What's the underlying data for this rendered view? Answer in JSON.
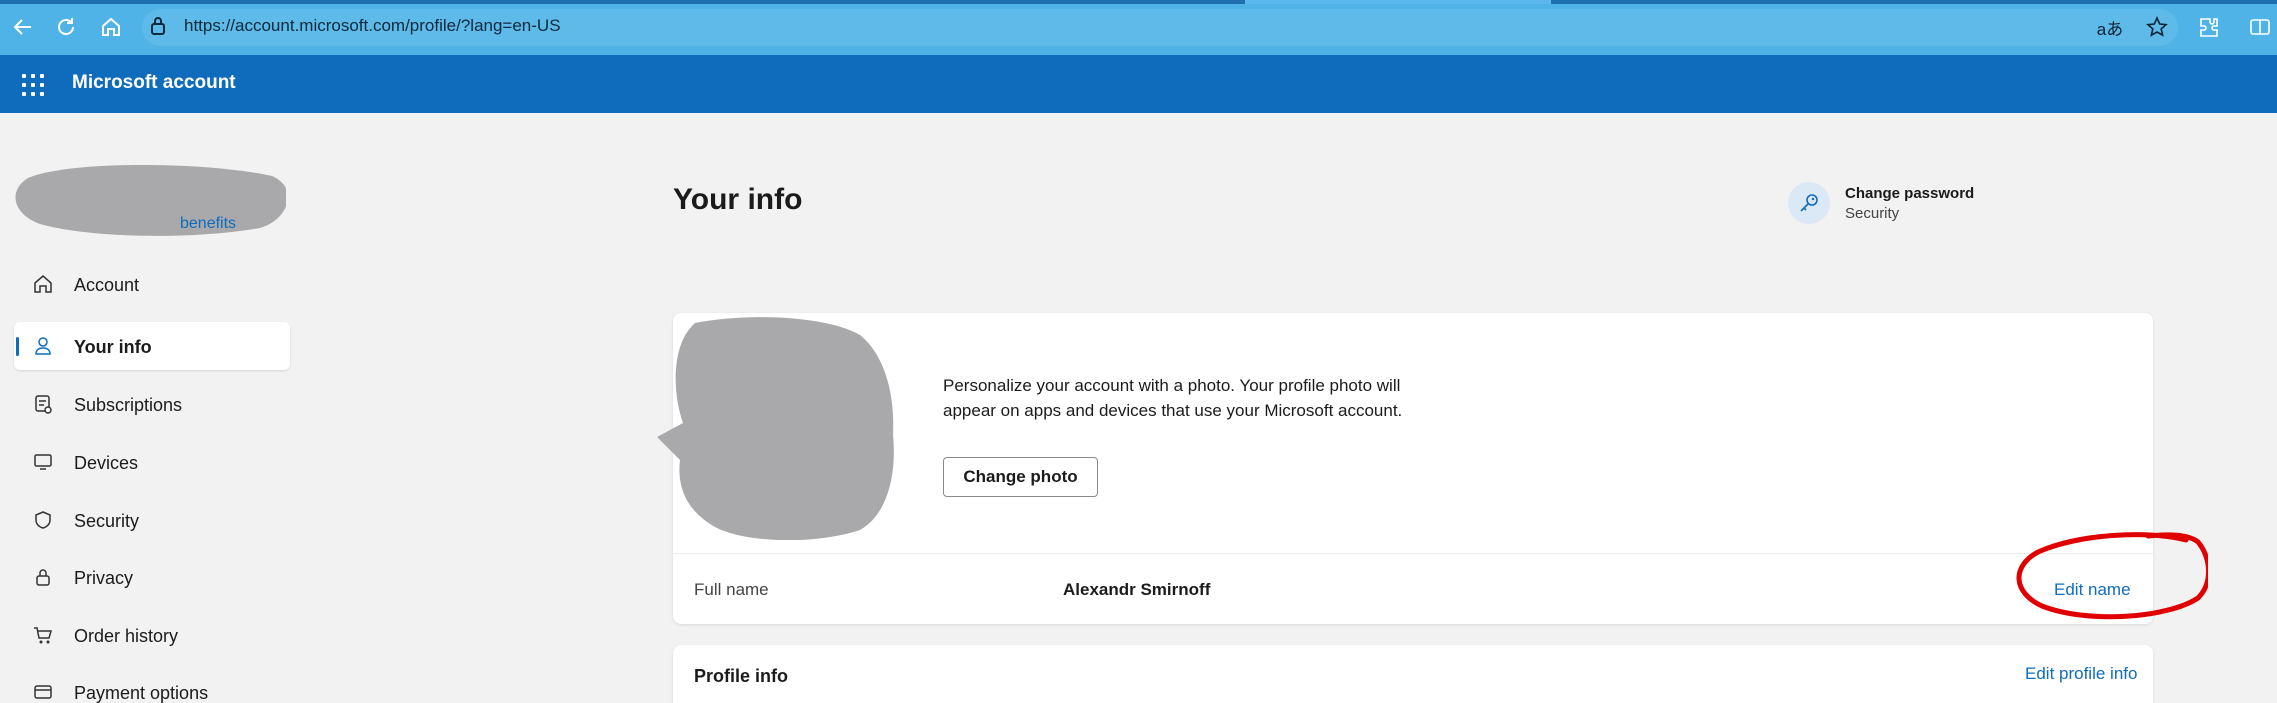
{
  "browser": {
    "url": "https://account.microsoft.com/profile/?lang=en-US",
    "read_aloud_glyph": "aあ"
  },
  "app": {
    "title": "Microsoft account"
  },
  "sidebar": {
    "benefits_link": "benefits",
    "items": [
      {
        "label": "Account",
        "icon": "home-icon",
        "active": false
      },
      {
        "label": "Your info",
        "icon": "person-icon",
        "active": true
      },
      {
        "label": "Subscriptions",
        "icon": "subscriptions-icon",
        "active": false
      },
      {
        "label": "Devices",
        "icon": "monitor-icon",
        "active": false
      },
      {
        "label": "Security",
        "icon": "shield-icon",
        "active": false
      },
      {
        "label": "Privacy",
        "icon": "lock-icon",
        "active": false
      },
      {
        "label": "Order history",
        "icon": "cart-icon",
        "active": false
      },
      {
        "label": "Payment options",
        "icon": "card-icon",
        "active": false
      }
    ]
  },
  "main": {
    "title": "Your info",
    "change_password": {
      "title": "Change password",
      "subtitle": "Security"
    },
    "photo_card": {
      "text": "Personalize your account with a photo. Your profile photo will appear on apps and devices that use your Microsoft account.",
      "change_photo_label": "Change photo"
    },
    "full_name": {
      "label": "Full name",
      "value": "Alexandr Smirnoff",
      "edit_label": "Edit name"
    },
    "profile_info": {
      "title": "Profile info",
      "edit_label": "Edit profile info"
    }
  },
  "colors": {
    "accent": "#0f6cbd",
    "browser_bar": "#4fb3e8",
    "annotation": "#e00000"
  }
}
